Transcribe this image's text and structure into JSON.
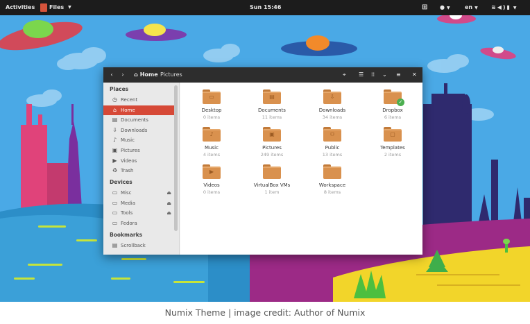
{
  "topbar": {
    "activities": "Activities",
    "app_menu": "Files",
    "clock": "Sun 15:46",
    "language": "en"
  },
  "headerbar": {
    "breadcrumb_home": "Home",
    "breadcrumb_current": "Pictures"
  },
  "sidebar": {
    "places_heading": "Places",
    "places": [
      {
        "label": "Recent",
        "icon": "clock-icon"
      },
      {
        "label": "Home",
        "icon": "home-icon",
        "active": true
      },
      {
        "label": "Documents",
        "icon": "document-icon"
      },
      {
        "label": "Downloads",
        "icon": "download-icon"
      },
      {
        "label": "Music",
        "icon": "music-icon"
      },
      {
        "label": "Pictures",
        "icon": "picture-icon"
      },
      {
        "label": "Videos",
        "icon": "video-icon"
      },
      {
        "label": "Trash",
        "icon": "trash-icon"
      }
    ],
    "devices_heading": "Devices",
    "devices": [
      {
        "label": "Misc",
        "icon": "drive-icon",
        "eject": true
      },
      {
        "label": "Media",
        "icon": "drive-icon",
        "eject": true
      },
      {
        "label": "Tools",
        "icon": "drive-icon",
        "eject": true
      },
      {
        "label": "Fedora",
        "icon": "drive-icon",
        "eject": false
      }
    ],
    "bookmarks_heading": "Bookmarks",
    "bookmarks": [
      {
        "label": "Scrollback",
        "icon": "bookmark-icon"
      }
    ]
  },
  "folders": [
    {
      "name": "Desktop",
      "count": "0 items",
      "icon": "desktop-folder-icon"
    },
    {
      "name": "Documents",
      "count": "11 items",
      "icon": "documents-folder-icon"
    },
    {
      "name": "Downloads",
      "count": "34 items",
      "icon": "downloads-folder-icon"
    },
    {
      "name": "Dropbox",
      "count": "6 items",
      "icon": "dropbox-folder-icon"
    },
    {
      "name": "Music",
      "count": "4 items",
      "icon": "music-folder-icon"
    },
    {
      "name": "Pictures",
      "count": "249 items",
      "icon": "pictures-folder-icon"
    },
    {
      "name": "Public",
      "count": "13 items",
      "icon": "public-folder-icon"
    },
    {
      "name": "Templates",
      "count": "2 items",
      "icon": "templates-folder-icon"
    },
    {
      "name": "Videos",
      "count": "0 items",
      "icon": "videos-folder-icon"
    },
    {
      "name": "VirtualBox VMs",
      "count": "1 item",
      "icon": "folder-icon"
    },
    {
      "name": "Workspace",
      "count": "8 items",
      "icon": "folder-icon"
    }
  ],
  "caption": "Numix Theme | image credit: Author of Numix",
  "colors": {
    "accent": "#d64937",
    "folder": "#d9914e",
    "headerbar": "#2d2d2d",
    "topbar": "#1c1c1c",
    "sky": "#4aa9e6"
  }
}
